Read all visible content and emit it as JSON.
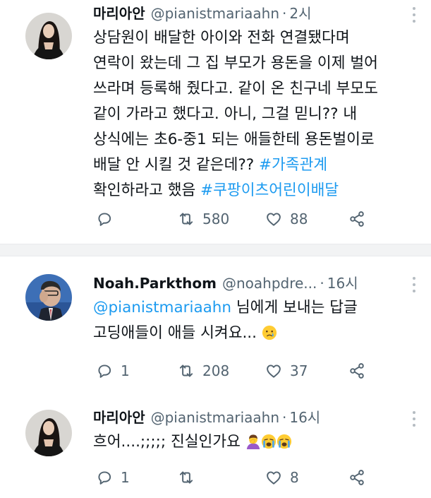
{
  "tweets": [
    {
      "name": "마리아안",
      "handle": "@pianistmariaahn",
      "dot": "·",
      "time": "2시",
      "lines": [
        "상담원이 배달한 아이와 전화 연결됐다며",
        "연락이 왔는데 그 집 부모가 용돈을 이제 벌어",
        "쓰라며 등록해 줬다고. 같이 온 친구네 부모도",
        "같이 가라고 했다고. 아니, 그걸 믿니?? 내",
        "상식에는 초6-중1 되는 애들한테 용돈벌이로",
        "배달 안 시킬 것 같은데?? ",
        "확인하라고 했음 "
      ],
      "hashtag1": "#가족관계",
      "hashtag2": "#쿠팡이츠어린이배달",
      "reply_count": "",
      "retweet_count": "580",
      "like_count": "88"
    },
    {
      "name": "Noah.Parkthom",
      "handle": "@noahpdre...",
      "dot": "·",
      "time": "16시",
      "mention": "@pianistmariaahn",
      "reply_to_text": " 님에게 보내는 답글",
      "text": "고딩애들이 애들 시켜요... ",
      "emoji": "crying-face-emoji",
      "reply_count": "1",
      "retweet_count": "208",
      "like_count": "37"
    },
    {
      "name": "마리아안",
      "handle": "@pianistmariaahn",
      "dot": "·",
      "time": "16시",
      "text": "흐어....;;;;; 진실인가요 ",
      "emojis": [
        "person-facepalming-emoji",
        "loudly-crying-face-emoji",
        "loudly-crying-face-emoji"
      ],
      "reply_count": "1",
      "retweet_count": "",
      "like_count": "8"
    }
  ],
  "icons": {
    "reply": "reply-icon",
    "retweet": "retweet-icon",
    "like": "heart-icon",
    "share": "share-icon",
    "more": "more-icon"
  },
  "colors": {
    "link": "#1d9bf0",
    "secondary_text": "#536471",
    "separator": "#f2f3f4"
  }
}
